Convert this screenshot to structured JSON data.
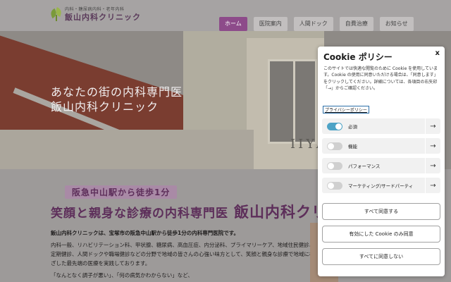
{
  "header": {
    "logo_sub": "内科・糖尿病内科・老年内科",
    "logo_main": "飯山内科クリニック",
    "nav": [
      {
        "label": "ホーム",
        "active": true
      },
      {
        "label": "医院案内",
        "active": false
      },
      {
        "label": "人間ドック",
        "active": false
      },
      {
        "label": "自費治療",
        "active": false
      },
      {
        "label": "お知らせ",
        "active": false
      }
    ]
  },
  "hero": {
    "title_line1": "あなたの街の内科専門医",
    "title_line2": "飯山内科クリニック",
    "sign": "IIYA"
  },
  "main": {
    "banner_line1": "阪急中山駅から徒歩1分",
    "banner_line2": "笑顔と親身な診療の内科専門医",
    "banner_big": "飯山内科クリニ",
    "paragraph1": "飯山内科クリニックは、宝塚市の阪急中山駅から徒歩1分の内科専門医院です。",
    "paragraph2": "内科一般、リハビリテーション科、甲状腺、糖尿病、高血圧症、内分泌科、プライマリーケア、地域住民健診、定期健診、人間ドックや職場健診などの分野で地域の皆さんの心強い味方として、笑顔と親身な診療で地域に根ざした最先端の医療を実践しております。",
    "paragraph3": "「なんとなく調子が悪い」、「何の病気かわからない」など、"
  },
  "cookie": {
    "title": "Cookie ポリシー",
    "close": "x",
    "description": "このサイトでは快適な閲覧のために Cookie を使用しています。Cookie の使用に同意いただける場合は、「同意します」をクリックしてください。詳細については、各項目の右矢印「→」からご確認ください。",
    "privacy_link": "プライバシーポリシー",
    "categories": [
      {
        "label": "必須",
        "on": true
      },
      {
        "label": "機能",
        "on": false
      },
      {
        "label": "パフォーマンス",
        "on": false
      },
      {
        "label": "マーケティング/サードパーティ",
        "on": false
      }
    ],
    "accept_all": "すべて同意する",
    "accept_selected": "有効にした Cookie のみ同意",
    "reject_all": "すべてに同意しない"
  },
  "colors": {
    "accent": "#8d4b8a",
    "toggle_on": "#4da3c6"
  }
}
